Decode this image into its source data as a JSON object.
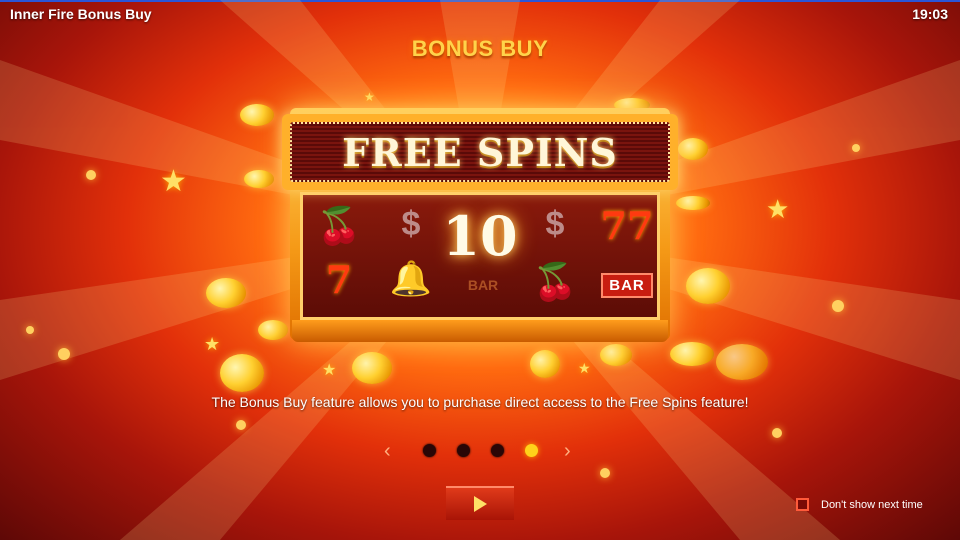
{
  "app": {
    "title": "Inner Fire Bonus Buy",
    "clock": "19:03"
  },
  "screen": {
    "title": "BONUS BUY"
  },
  "machine": {
    "marquee": "FREE SPINS",
    "spins_value": "10",
    "bar_label": "BAR",
    "reels_icons": [
      "cherry-icon",
      "seven-icon",
      "dollar-coin-icon",
      "bell-icon",
      "cherry-icon",
      "double-seven-icon",
      "bar-icon"
    ]
  },
  "description": "The Bonus Buy feature allows you to purchase direct access to the Free Spins feature!",
  "pager": {
    "prev_icon": "‹",
    "next_icon": "›",
    "pages": 4,
    "current_page": 4
  },
  "footer": {
    "dont_show_label": "Don't show next time",
    "play_icon": "play-icon"
  },
  "colors": {
    "accent": "#ffd21a",
    "title": "#ffd34a",
    "button": "#c81d10"
  }
}
